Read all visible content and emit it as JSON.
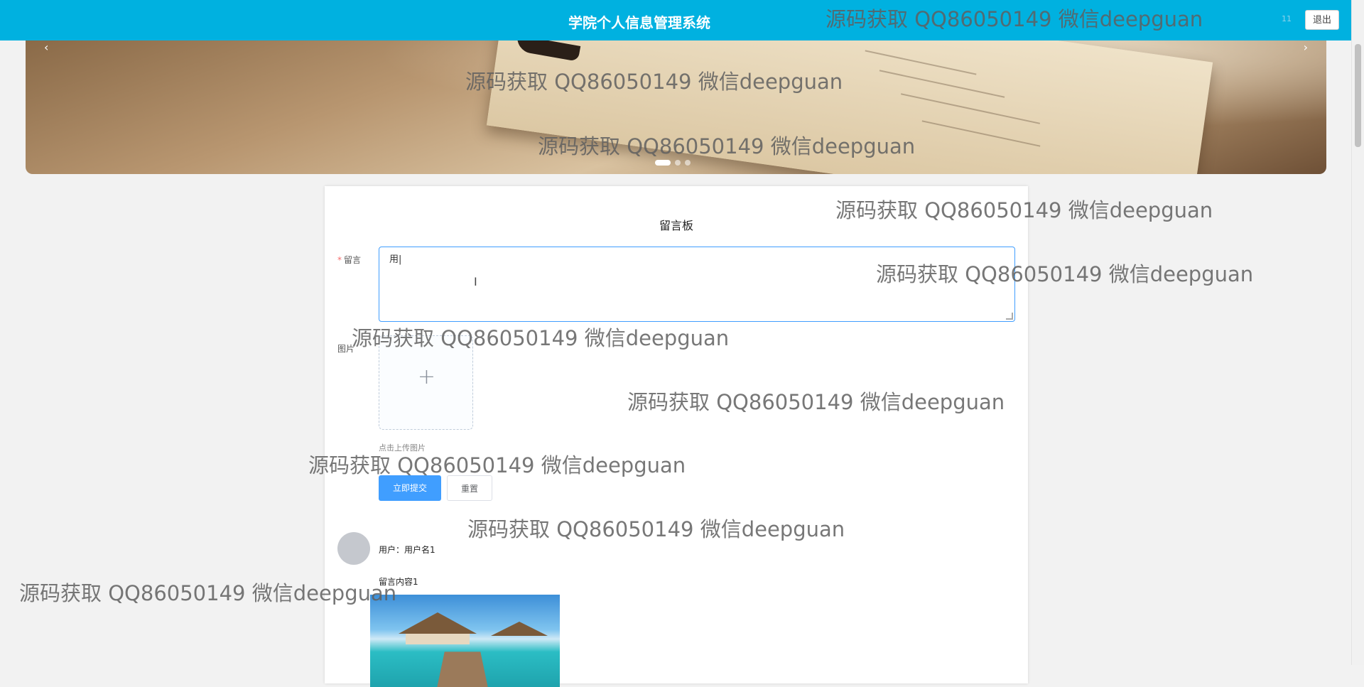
{
  "header": {
    "title": "学院个人信息管理系统",
    "username": "11",
    "logout_label": "退出"
  },
  "carousel": {
    "prev_icon": "‹",
    "next_icon": "›",
    "slide_count": 3,
    "active_index": 0
  },
  "board": {
    "title": "留言板",
    "message_label": "留言",
    "message_value": "用|",
    "image_label": "图片",
    "upload_plus": "+",
    "upload_tip": "点击上传图片",
    "submit_label": "立即提交",
    "reset_label": "重置"
  },
  "comments": [
    {
      "user": "用户：用户名1",
      "content": "留言内容1"
    }
  ],
  "watermark": "源码获取 QQ86050149 微信deepguan",
  "colors": {
    "header": "#00b1e0",
    "primary": "#409eff",
    "required": "#f56c6c"
  }
}
